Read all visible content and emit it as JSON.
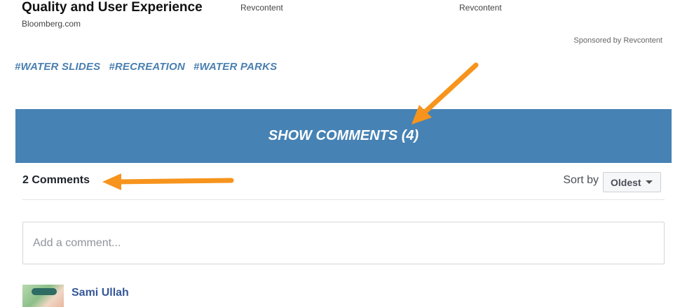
{
  "ad": {
    "title": "Quality and User Experience",
    "source": "Bloomberg.com",
    "col1": "Revcontent",
    "col2": "Revcontent",
    "sponsored": "Sponsored by Revcontent"
  },
  "tags": [
    "#WATER SLIDES",
    "#RECREATION",
    "#WATER PARKS"
  ],
  "show_comments_label": "SHOW COMMENTS (4)",
  "comments": {
    "count_label": "2 Comments",
    "sort_label": "Sort by",
    "sort_value": "Oldest",
    "input_placeholder": "Add a comment...",
    "first_commenter": "Sami Ullah"
  },
  "colors": {
    "accent_blue": "#4682b4",
    "tag_blue": "#4a7fb0",
    "annotation_orange": "#f7941d"
  }
}
